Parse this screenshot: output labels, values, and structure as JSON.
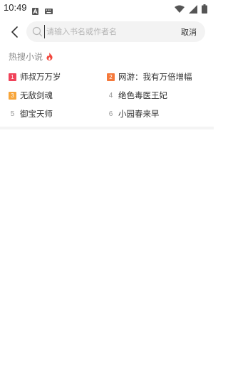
{
  "status_bar": {
    "time": "10:49",
    "left_icons": [
      "a-notification-icon",
      "keyboard-icon"
    ],
    "right_icons": [
      "wifi-icon",
      "cellular-signal-icon",
      "battery-icon"
    ]
  },
  "search": {
    "placeholder": "请输入书名或作者名",
    "value": "",
    "cancel_label": "取消"
  },
  "hot": {
    "title": "热搜小说",
    "flame_color": "#f2473d",
    "items": [
      {
        "rank": "1",
        "name": "师叔万万岁",
        "badge_color": "#f0435a"
      },
      {
        "rank": "2",
        "name": "网游：我有万倍增幅",
        "badge_color": "#f5793b"
      },
      {
        "rank": "3",
        "name": "无敌剑魂",
        "badge_color": "#f7a53a"
      },
      {
        "rank": "4",
        "name": "绝色毒医王妃",
        "badge_color": ""
      },
      {
        "rank": "5",
        "name": "御宝天师",
        "badge_color": ""
      },
      {
        "rank": "6",
        "name": "小园春来早",
        "badge_color": ""
      }
    ]
  }
}
